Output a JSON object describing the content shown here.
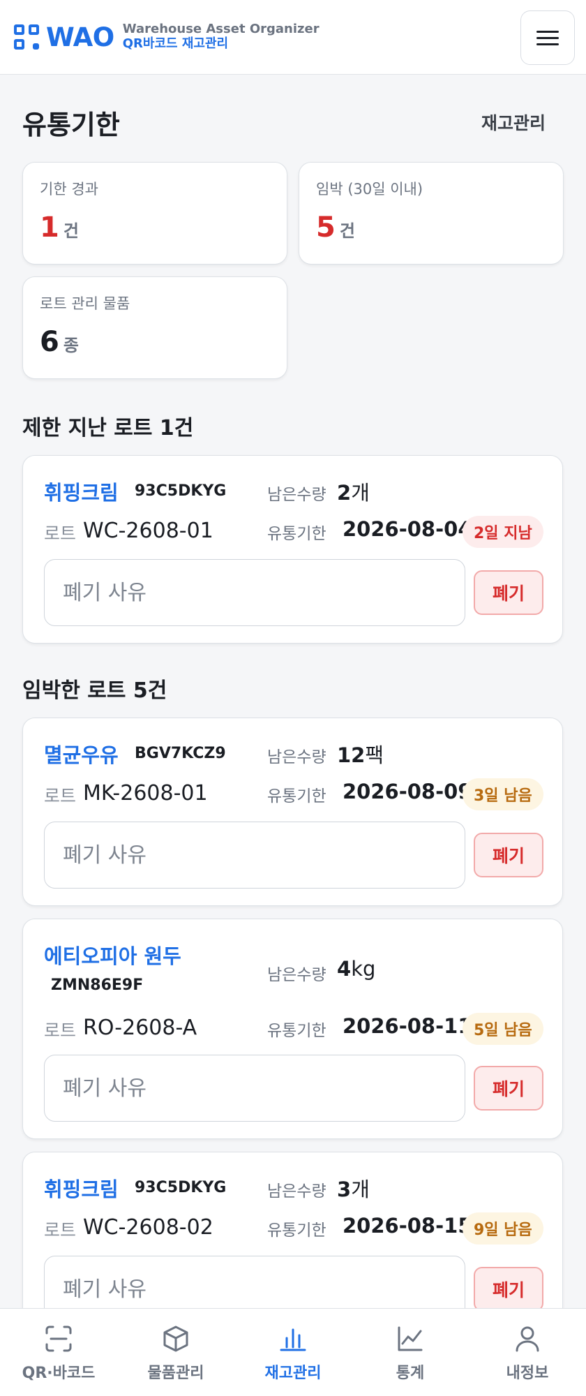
{
  "header": {
    "brand": "WAO",
    "subtitle_en": "Warehouse Asset Organizer",
    "subtitle_ko": "QR바코드 재고관리",
    "menu_icon": "hamburger-icon"
  },
  "page": {
    "title": "유통기한",
    "link": "재고관리"
  },
  "summary": {
    "expired": {
      "label": "기한 경과",
      "value": "1",
      "unit": "건"
    },
    "imminent": {
      "label": "임박 (30일 이내)",
      "value": "5",
      "unit": "건"
    },
    "lot_items": {
      "label": "로트 관리 물품",
      "value": "6",
      "unit": "종"
    }
  },
  "sections": {
    "expired_title": "제한 지난 로트 1건",
    "imminent_title": "임박한 로트 5건"
  },
  "labels": {
    "qty": "남은수량",
    "lot": "로트",
    "expiry": "유통기한",
    "reason_placeholder": "폐기 사유",
    "dispose": "폐기"
  },
  "expired_lots": [
    {
      "name": "휘핑크림",
      "code": "93C5DKYG",
      "qty": "2",
      "qty_unit": "개",
      "lot": "WC-2608-01",
      "expiry": "2026-08-04",
      "badge": "2일 지남"
    }
  ],
  "imminent_lots": [
    {
      "name": "멸균우유",
      "code": "BGV7KCZ9",
      "qty": "12",
      "qty_unit": "팩",
      "lot": "MK-2608-01",
      "expiry": "2026-08-09",
      "badge": "3일 남음"
    },
    {
      "name": "에티오피아 원두",
      "code": "ZMN86E9F",
      "qty": "4",
      "qty_unit": "kg",
      "lot": "RO-2608-A",
      "expiry": "2026-08-11",
      "badge": "5일 남음"
    },
    {
      "name": "휘핑크림",
      "code": "93C5DKYG",
      "qty": "3",
      "qty_unit": "개",
      "lot": "WC-2608-02",
      "expiry": "2026-08-15",
      "badge": "9일 남음"
    }
  ],
  "nav": [
    {
      "label": "QR·바코드",
      "icon": "scan-icon"
    },
    {
      "label": "물품관리",
      "icon": "box-icon"
    },
    {
      "label": "재고관리",
      "icon": "bar-chart-icon",
      "active": true
    },
    {
      "label": "통계",
      "icon": "line-chart-icon"
    },
    {
      "label": "내정보",
      "icon": "user-icon"
    }
  ],
  "colors": {
    "accent": "#1f6fe5",
    "danger": "#d62b2b",
    "warning": "#b76a0f"
  }
}
